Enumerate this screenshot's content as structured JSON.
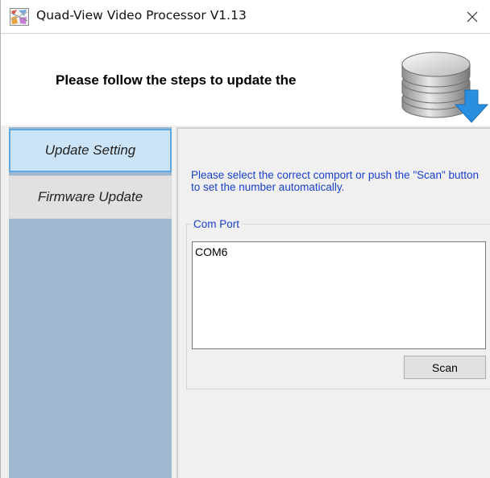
{
  "window": {
    "title": "Quad-View Video Processor V1.13",
    "close_glyph": "✕"
  },
  "header": {
    "text": "Please follow the steps to update the",
    "icon": "database-download-icon"
  },
  "sidebar": {
    "items": [
      {
        "label": "Update Setting",
        "active": true
      },
      {
        "label": "Firmware Update",
        "active": false
      }
    ]
  },
  "content": {
    "instructions": "Please select the correct comport or push the \"Scan\" button to set the number automatically.",
    "comport_group": {
      "label": "Com Port",
      "items": [
        "COM6"
      ]
    },
    "scan_button": "Scan"
  },
  "colors": {
    "sidebar_bg": "#9fb7cf",
    "active_tab_bg": "#cce4f7",
    "active_tab_border": "#5fa8df",
    "instruction_text": "#1a3fcc",
    "download_arrow": "#2a8fe0"
  }
}
